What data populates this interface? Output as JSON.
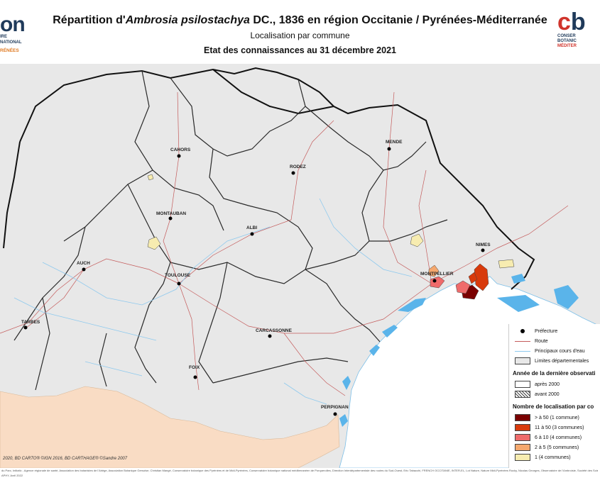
{
  "header": {
    "title_prefix": "Répartition d'",
    "title_species": "Ambrosia psilostachya",
    "title_suffix": "  DC., 1836 en région Occitanie / Pyrénées-Méditerranée",
    "subtitle": "Localisation par commune",
    "date_line": "Etat des connaissances au 31 décembre 2021"
  },
  "logo_left": {
    "big": "on",
    "line1": "IRE",
    "line2": "NATIONAL",
    "region": "RÉNÉES"
  },
  "logo_right": {
    "big_c": "c",
    "big_b": "b",
    "line1": "CONSER",
    "line2": "BOTANIC",
    "region": "MÉDITER"
  },
  "cities": [
    {
      "name": "CAHORS"
    },
    {
      "name": "RODEZ"
    },
    {
      "name": "MENDE"
    },
    {
      "name": "MONTAUBAN"
    },
    {
      "name": "ALBI"
    },
    {
      "name": "NIMES"
    },
    {
      "name": "AUCH"
    },
    {
      "name": "TOULOUSE"
    },
    {
      "name": "MONTPELLIER"
    },
    {
      "name": "TARBES"
    },
    {
      "name": "CARCASSONNE"
    },
    {
      "name": "FOIX"
    },
    {
      "name": "PERPIGNAN"
    }
  ],
  "colors": {
    "land": "#e8e8e8",
    "spain": "#f9dcc4",
    "sea": "#ffffff",
    "border_dept": "#2a2a2a",
    "road": "#c45b5b",
    "river": "#8ec9ee",
    "lake": "#5ab4ea",
    "class_gt50": "#7a0000",
    "class_11_50": "#d83a0c",
    "class_6_10": "#ef6b6b",
    "class_2_5": "#f5a86e",
    "class_1": "#f7ecb0"
  },
  "legend": {
    "prefecture": "Préfecture",
    "road": "Route",
    "rivers": "Principaux cours d'eau",
    "departments": "Limites départementales",
    "year_title": "Année de la dernière observati",
    "after_2000": "après 2000",
    "before_2000": "avant 2000",
    "count_title": "Nombre de localisation par co",
    "classes": [
      {
        "label": "> à 50 (1 commune)",
        "color": "#7a0000"
      },
      {
        "label": "11 à 50 (3 communes)",
        "color": "#d83a0c"
      },
      {
        "label": "6 à 10 (4 communes)",
        "color": "#ef6b6b"
      },
      {
        "label": "2 à 5 (5 communes)",
        "color": "#f5a86e"
      },
      {
        "label": "1 (4 communes)",
        "color": "#f7ecb0"
      }
    ]
  },
  "footer": {
    "copyright": "2020, BD CARTO® ©IGN 2016, BD CARTHAGE® ©Sandre 2007",
    "credits": "du Parc, Initiativ - Agence régionale de santé, Association des botanistes de l'Ariège, Association Botanique Gersoise, Christian Mangé, Conservatoire botanique des Pyrénées et de Midi-Pyrénées, Conservatoire botanique national méditerranéen de Porquerolles, Direction Interdépartementale des routes du Sud-Ouest, Eric Tabacchi, FRENCH OCCITANIE, INTER-EL, Lot Nature, Nature Midi-Pyrénées Rocky, Nicolas Georges, Observatoire de l'Ambroisie, Société des Sciences Naturelles de Tarn et Garonne",
    "credits2": "APHY, Avril 2022"
  }
}
